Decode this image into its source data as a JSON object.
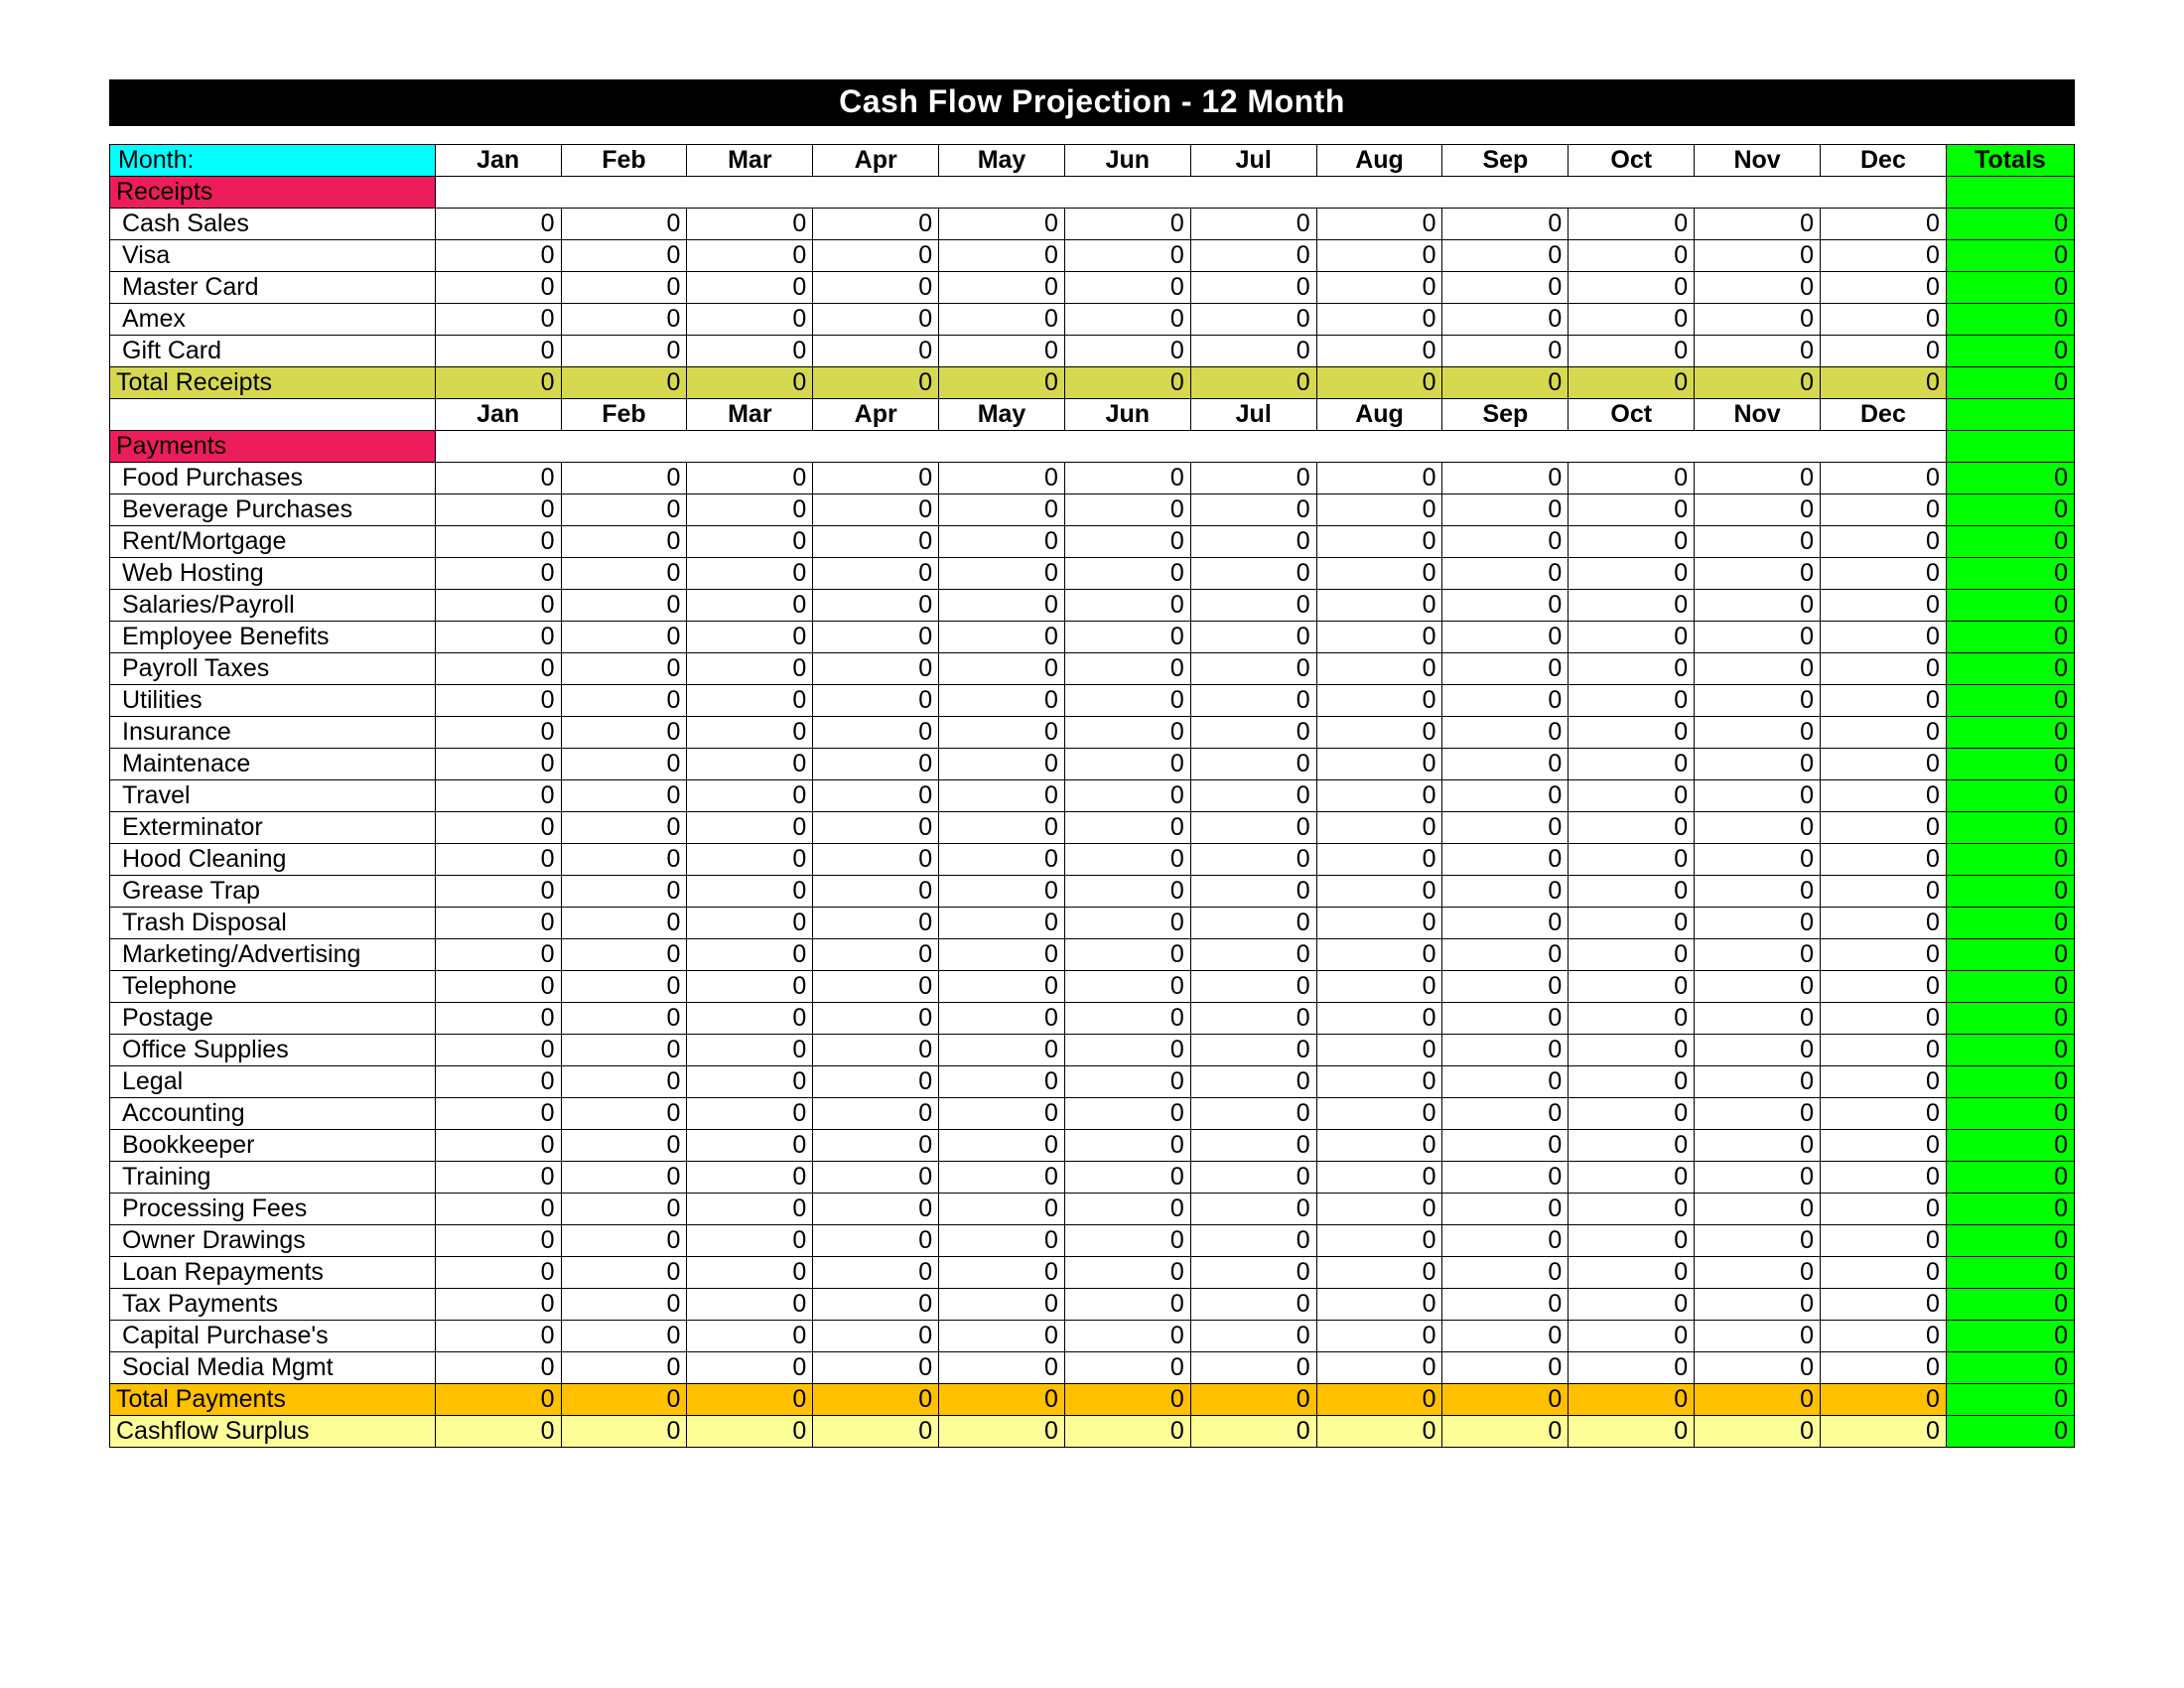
{
  "title": "Cash Flow Projection    -     12 Month",
  "month_label": "Month:",
  "months": [
    "Jan",
    "Feb",
    "Mar",
    "Apr",
    "May",
    "Jun",
    "Jul",
    "Aug",
    "Sep",
    "Oct",
    "Nov",
    "Dec"
  ],
  "totals_label": "Totals",
  "sections": {
    "receipts": {
      "header": "Receipts",
      "rows": [
        {
          "label": "Cash Sales",
          "values": [
            0,
            0,
            0,
            0,
            0,
            0,
            0,
            0,
            0,
            0,
            0,
            0
          ],
          "total": 0
        },
        {
          "label": "Visa",
          "values": [
            0,
            0,
            0,
            0,
            0,
            0,
            0,
            0,
            0,
            0,
            0,
            0
          ],
          "total": 0
        },
        {
          "label": "Master Card",
          "values": [
            0,
            0,
            0,
            0,
            0,
            0,
            0,
            0,
            0,
            0,
            0,
            0
          ],
          "total": 0
        },
        {
          "label": "Amex",
          "values": [
            0,
            0,
            0,
            0,
            0,
            0,
            0,
            0,
            0,
            0,
            0,
            0
          ],
          "total": 0
        },
        {
          "label": "Gift Card",
          "values": [
            0,
            0,
            0,
            0,
            0,
            0,
            0,
            0,
            0,
            0,
            0,
            0
          ],
          "total": 0
        }
      ],
      "total_label": "Total Receipts",
      "total_values": [
        0,
        0,
        0,
        0,
        0,
        0,
        0,
        0,
        0,
        0,
        0,
        0
      ],
      "total_total": 0
    },
    "payments": {
      "header": "Payments",
      "rows": [
        {
          "label": "Food Purchases",
          "values": [
            0,
            0,
            0,
            0,
            0,
            0,
            0,
            0,
            0,
            0,
            0,
            0
          ],
          "total": 0
        },
        {
          "label": "Beverage Purchases",
          "values": [
            0,
            0,
            0,
            0,
            0,
            0,
            0,
            0,
            0,
            0,
            0,
            0
          ],
          "total": 0
        },
        {
          "label": "Rent/Mortgage",
          "values": [
            0,
            0,
            0,
            0,
            0,
            0,
            0,
            0,
            0,
            0,
            0,
            0
          ],
          "total": 0
        },
        {
          "label": "Web Hosting",
          "values": [
            0,
            0,
            0,
            0,
            0,
            0,
            0,
            0,
            0,
            0,
            0,
            0
          ],
          "total": 0
        },
        {
          "label": "Salaries/Payroll",
          "values": [
            0,
            0,
            0,
            0,
            0,
            0,
            0,
            0,
            0,
            0,
            0,
            0
          ],
          "total": 0
        },
        {
          "label": "Employee Benefits",
          "values": [
            0,
            0,
            0,
            0,
            0,
            0,
            0,
            0,
            0,
            0,
            0,
            0
          ],
          "total": 0
        },
        {
          "label": "Payroll Taxes",
          "values": [
            0,
            0,
            0,
            0,
            0,
            0,
            0,
            0,
            0,
            0,
            0,
            0
          ],
          "total": 0
        },
        {
          "label": "Utilities",
          "values": [
            0,
            0,
            0,
            0,
            0,
            0,
            0,
            0,
            0,
            0,
            0,
            0
          ],
          "total": 0
        },
        {
          "label": "Insurance",
          "values": [
            0,
            0,
            0,
            0,
            0,
            0,
            0,
            0,
            0,
            0,
            0,
            0
          ],
          "total": 0
        },
        {
          "label": "Maintenace",
          "values": [
            0,
            0,
            0,
            0,
            0,
            0,
            0,
            0,
            0,
            0,
            0,
            0
          ],
          "total": 0
        },
        {
          "label": "Travel",
          "values": [
            0,
            0,
            0,
            0,
            0,
            0,
            0,
            0,
            0,
            0,
            0,
            0
          ],
          "total": 0
        },
        {
          "label": "Exterminator",
          "values": [
            0,
            0,
            0,
            0,
            0,
            0,
            0,
            0,
            0,
            0,
            0,
            0
          ],
          "total": 0
        },
        {
          "label": "Hood Cleaning",
          "values": [
            0,
            0,
            0,
            0,
            0,
            0,
            0,
            0,
            0,
            0,
            0,
            0
          ],
          "total": 0
        },
        {
          "label": "Grease Trap",
          "values": [
            0,
            0,
            0,
            0,
            0,
            0,
            0,
            0,
            0,
            0,
            0,
            0
          ],
          "total": 0
        },
        {
          "label": "Trash Disposal",
          "values": [
            0,
            0,
            0,
            0,
            0,
            0,
            0,
            0,
            0,
            0,
            0,
            0
          ],
          "total": 0
        },
        {
          "label": "Marketing/Advertising",
          "values": [
            0,
            0,
            0,
            0,
            0,
            0,
            0,
            0,
            0,
            0,
            0,
            0
          ],
          "total": 0
        },
        {
          "label": "Telephone",
          "values": [
            0,
            0,
            0,
            0,
            0,
            0,
            0,
            0,
            0,
            0,
            0,
            0
          ],
          "total": 0
        },
        {
          "label": "Postage",
          "values": [
            0,
            0,
            0,
            0,
            0,
            0,
            0,
            0,
            0,
            0,
            0,
            0
          ],
          "total": 0
        },
        {
          "label": "Office Supplies",
          "values": [
            0,
            0,
            0,
            0,
            0,
            0,
            0,
            0,
            0,
            0,
            0,
            0
          ],
          "total": 0
        },
        {
          "label": "Legal",
          "values": [
            0,
            0,
            0,
            0,
            0,
            0,
            0,
            0,
            0,
            0,
            0,
            0
          ],
          "total": 0
        },
        {
          "label": "Accounting",
          "values": [
            0,
            0,
            0,
            0,
            0,
            0,
            0,
            0,
            0,
            0,
            0,
            0
          ],
          "total": 0
        },
        {
          "label": "Bookkeeper",
          "values": [
            0,
            0,
            0,
            0,
            0,
            0,
            0,
            0,
            0,
            0,
            0,
            0
          ],
          "total": 0
        },
        {
          "label": "Training",
          "values": [
            0,
            0,
            0,
            0,
            0,
            0,
            0,
            0,
            0,
            0,
            0,
            0
          ],
          "total": 0
        },
        {
          "label": "Processing Fees",
          "values": [
            0,
            0,
            0,
            0,
            0,
            0,
            0,
            0,
            0,
            0,
            0,
            0
          ],
          "total": 0
        },
        {
          "label": "Owner Drawings",
          "values": [
            0,
            0,
            0,
            0,
            0,
            0,
            0,
            0,
            0,
            0,
            0,
            0
          ],
          "total": 0
        },
        {
          "label": "Loan Repayments",
          "values": [
            0,
            0,
            0,
            0,
            0,
            0,
            0,
            0,
            0,
            0,
            0,
            0
          ],
          "total": 0
        },
        {
          "label": "Tax Payments",
          "values": [
            0,
            0,
            0,
            0,
            0,
            0,
            0,
            0,
            0,
            0,
            0,
            0
          ],
          "total": 0
        },
        {
          "label": "Capital Purchase's",
          "values": [
            0,
            0,
            0,
            0,
            0,
            0,
            0,
            0,
            0,
            0,
            0,
            0
          ],
          "total": 0
        },
        {
          "label": "Social Media Mgmt",
          "values": [
            0,
            0,
            0,
            0,
            0,
            0,
            0,
            0,
            0,
            0,
            0,
            0
          ],
          "total": 0
        }
      ],
      "total_label": "Total Payments",
      "total_values": [
        0,
        0,
        0,
        0,
        0,
        0,
        0,
        0,
        0,
        0,
        0,
        0
      ],
      "total_total": 0
    }
  },
  "cashflow_surplus": {
    "label": "Cashflow Surplus",
    "values": [
      0,
      0,
      0,
      0,
      0,
      0,
      0,
      0,
      0,
      0,
      0,
      0
    ],
    "total": 0
  }
}
